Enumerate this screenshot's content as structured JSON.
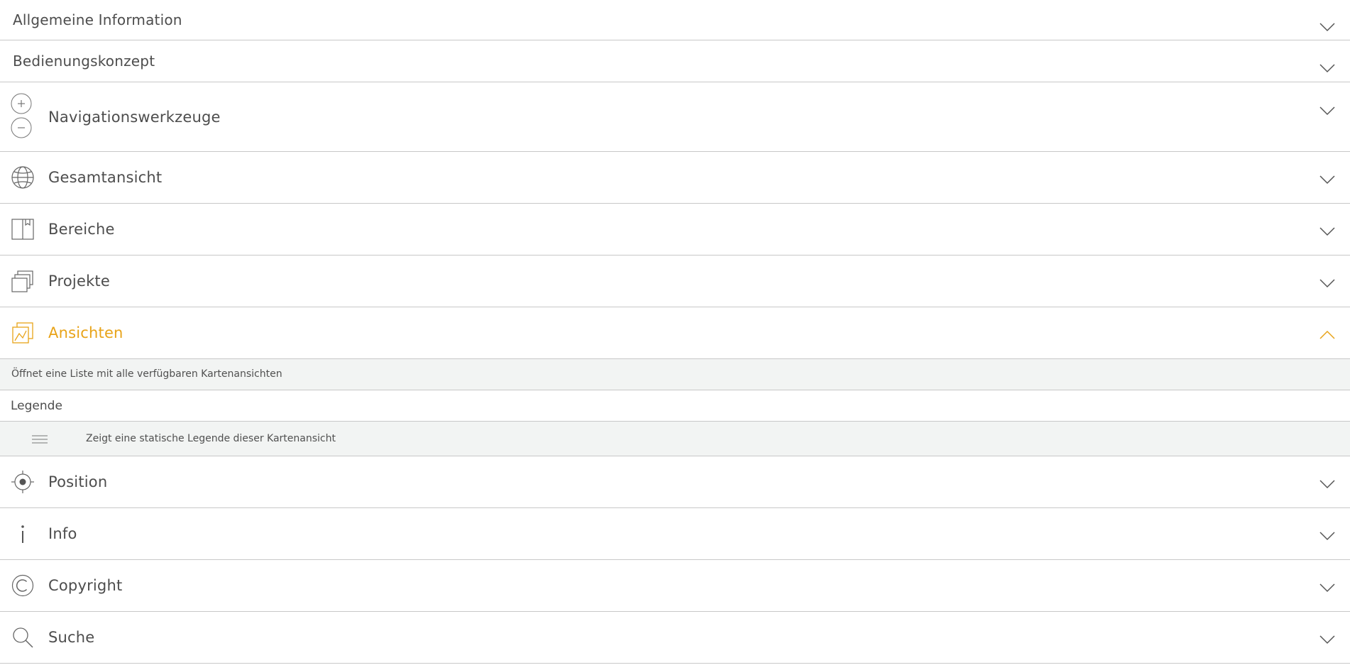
{
  "colors": {
    "accent": "#e8a318",
    "text": "#4d4d4d",
    "divider": "#c8c8c8",
    "subtle_bg": "#f2f4f3"
  },
  "sections": {
    "allgemeine": {
      "label": "Allgemeine Information",
      "icon": "chevron-down-icon"
    },
    "bedienung": {
      "label": "Bedienungskonzept",
      "icon": "chevron-down-icon"
    },
    "navigation": {
      "label": "Navigationswerkzeuge",
      "icons": [
        "zoom-in-icon",
        "zoom-out-icon"
      ]
    },
    "gesamtansicht": {
      "label": "Gesamtansicht",
      "icon": "globe-icon"
    },
    "bereiche": {
      "label": "Bereiche",
      "icon": "book-icon"
    },
    "projekte": {
      "label": "Projekte",
      "icon": "stacked-windows-icon"
    },
    "ansichten": {
      "label": "Ansichten",
      "icon": "map-views-icon",
      "expanded": true,
      "description": "Öffnet eine Liste mit alle verfügbaren Kartenansichten",
      "subsection_title": "Legende",
      "legend_item": {
        "icon": "legend-lines-icon",
        "text": "Zeigt eine statische Legende dieser Kartenansicht"
      }
    },
    "position": {
      "label": "Position",
      "icon": "crosshair-icon"
    },
    "info": {
      "label": "Info",
      "icon": "info-icon"
    },
    "copyright": {
      "label": "Copyright",
      "icon": "copyright-icon"
    },
    "suche": {
      "label": "Suche",
      "icon": "search-icon"
    }
  }
}
